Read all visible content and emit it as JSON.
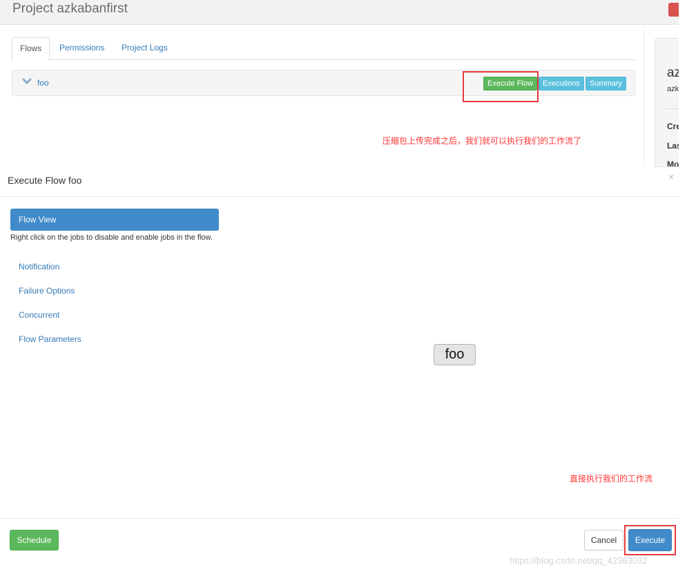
{
  "project": {
    "title": "Project azkabanfirst",
    "tabs": [
      {
        "label": "Flows",
        "active": true
      },
      {
        "label": "Permissions",
        "active": false
      },
      {
        "label": "Project Logs",
        "active": false
      }
    ],
    "flow": {
      "name": "foo",
      "buttons": {
        "execute": "Execute Flow",
        "executions": "Executions",
        "summary": "Summary"
      }
    },
    "side_panel": {
      "title": "az",
      "subtitle": "azk",
      "labels": [
        "Cre",
        "Las",
        "Mo"
      ]
    }
  },
  "annotations": {
    "upload_note": "压缩包上传完成之后，我们就可以执行我们的工作流了",
    "execute_note": "直接执行我们的工作流"
  },
  "modal": {
    "title": "Execute Flow foo",
    "close": "×",
    "sidebar": {
      "active_item": "Flow View",
      "help_text": "Right click on the jobs to disable and enable jobs in the flow.",
      "items": [
        "Notification",
        "Failure Options",
        "Concurrent",
        "Flow Parameters"
      ]
    },
    "graph": {
      "nodes": [
        "foo"
      ]
    },
    "footer": {
      "schedule": "Schedule",
      "cancel": "Cancel",
      "execute": "Execute"
    }
  },
  "watermark": "https://blog.csdn.net/qq_42363032",
  "colors": {
    "primary": "#428bca",
    "success": "#5cb85c",
    "info": "#5bc0de",
    "danger": "#d9534f",
    "annotation": "#ff3333",
    "link": "#337ab7"
  }
}
